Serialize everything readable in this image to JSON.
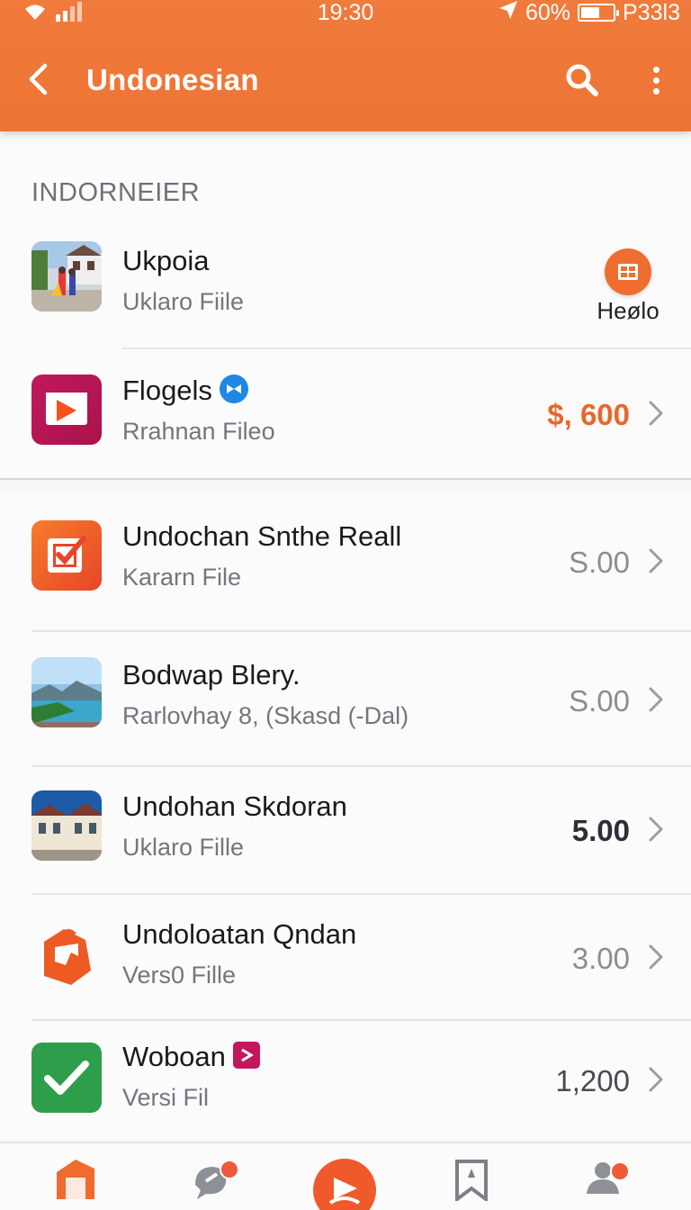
{
  "status": {
    "time": "19:30",
    "battery": "60%",
    "battery_level": 0.6,
    "carrier": "P33l3"
  },
  "appbar": {
    "title": "Undonesian"
  },
  "section1": {
    "header": "INDORNEIER"
  },
  "items": [
    {
      "name": "Ukpoia",
      "sub": "Uklaro Fiile",
      "action_label": "Heølo"
    },
    {
      "name": "Flogels",
      "sub": "Rrahnan Fileo",
      "price": "$, 600"
    },
    {
      "name": "Undochan Snthe Reall",
      "sub": "Kararn File",
      "price": "S.00"
    },
    {
      "name": "Bodwap Blery.",
      "sub": "Rarlovhay  8, (Skasd (-Dal)",
      "price": "S.00"
    },
    {
      "name": "Undohan  Skdoran",
      "sub": "Uklaro Fille",
      "price": "5.00"
    },
    {
      "name": "Undoloatan Qndan",
      "sub": "Vers0 Fille",
      "price": "3.00"
    },
    {
      "name": "Woboan",
      "sub": "Versi Fil",
      "price": "1,200"
    }
  ],
  "colors": {
    "accent": "#ee7435",
    "price_highlight": "#e8672a",
    "price_dark": "#2b2f36"
  },
  "bottom_nav": {
    "items": [
      "home-icon",
      "chat-icon",
      "play-icon",
      "bookmark-icon",
      "people-icon"
    ]
  }
}
